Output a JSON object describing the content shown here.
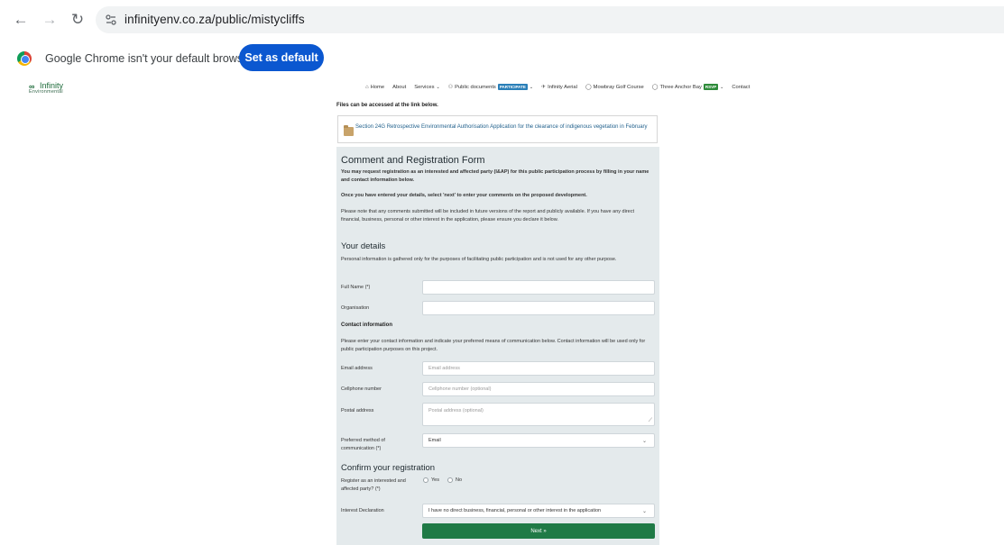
{
  "browser": {
    "url": "infinityenv.co.za/public/mistycliffs",
    "infobar_text": "Google Chrome isn't your default browser",
    "set_default_label": "Set as default"
  },
  "site": {
    "logo_mark": "∞",
    "logo_name": "Infinity",
    "logo_sub": "Environmental",
    "menu": [
      {
        "label": "Home",
        "icon": "home-icon"
      },
      {
        "label": "About"
      },
      {
        "label": "Services"
      },
      {
        "label": "Public documents",
        "badge": "PARTICIPATE"
      },
      {
        "label": "Infinity Aerial"
      },
      {
        "label": "Mowbray Golf Course"
      },
      {
        "label": "Three Anchor Bay",
        "badge": "RSVP"
      },
      {
        "label": "Contact"
      }
    ]
  },
  "content": {
    "files_note": "Files can be accessed at the link below.",
    "file_link": "Section 24G Retrospective Environmental Authorisation Application for the clearance of indigenous vegetation in February"
  },
  "form": {
    "title": "Comment and Registration Form",
    "intro1": "You may request registration as an interested and affected party (I&AP) for this public participation process by filling in your name and contact information below.",
    "intro2": "Once you have entered your details, select 'next' to enter your comments on the proposed development.",
    "intro3": "Please note that any comments submitted will be included in future versions of the report and publicly available. If you have any direct financial, business, personal or other interest in the application, please ensure you declare it below.",
    "details_heading": "Your details",
    "details_note": "Personal information is gathered only for the purposes of facilitating public participation and is not used for any other purpose.",
    "full_name_label": "Full Name (*)",
    "organisation_label": "Organisation",
    "contact_heading": "Contact information",
    "contact_note": "Please enter your contact information and indicate your preferred means of communication below. Contact information will be used only for public participation purposes on this project.",
    "email_label": "Email address",
    "email_placeholder": "Email address",
    "cell_label": "Cellphone number",
    "cell_placeholder": "Cellphone number (optional)",
    "postal_label": "Postal address",
    "postal_placeholder": "Postal address (optional)",
    "method_label": "Preferred method of communication (*)",
    "method_value": "Email",
    "confirm_heading": "Confirm your registration",
    "register_label": "Register as an interested and affected party? (*)",
    "yes_label": "Yes",
    "no_label": "No",
    "interest_label": "Interest Declaration",
    "interest_value": "I have no direct business, financial, personal or other interest in the application",
    "next_label": "Next »"
  }
}
